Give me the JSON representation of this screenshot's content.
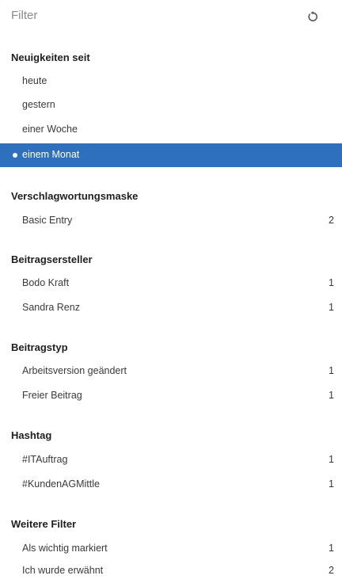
{
  "header": {
    "title": "Filter",
    "reset_icon": "reset-icon"
  },
  "sections": [
    {
      "title": "Neuigkeiten seit",
      "items": [
        {
          "label": "heute",
          "count": ""
        },
        {
          "label": "gestern",
          "count": ""
        },
        {
          "label": "einer Woche",
          "count": ""
        },
        {
          "label": "einem Monat",
          "count": "",
          "selected": true
        }
      ]
    },
    {
      "title": "Verschlagwortungsmaske",
      "items": [
        {
          "label": "Basic Entry",
          "count": "2"
        }
      ]
    },
    {
      "title": "Beitragsersteller",
      "items": [
        {
          "label": "Bodo Kraft",
          "count": "1"
        },
        {
          "label": "Sandra Renz",
          "count": "1"
        }
      ]
    },
    {
      "title": "Beitragstyp",
      "items": [
        {
          "label": "Arbeitsversion geändert",
          "count": "1"
        },
        {
          "label": "Freier Beitrag",
          "count": "1"
        }
      ]
    },
    {
      "title": "Hashtag",
      "items": [
        {
          "label": "#ITAuftrag",
          "count": "1"
        },
        {
          "label": "#KundenAGMittle",
          "count": "1"
        }
      ]
    },
    {
      "title": "Weitere Filter",
      "items": [
        {
          "label": "Als wichtig markiert",
          "count": "1"
        },
        {
          "label": "Ich wurde erwähnt",
          "count": "2"
        }
      ]
    }
  ],
  "colors": {
    "selected_bg": "#2e6fbe",
    "text": "#333333",
    "muted": "#8a8a8a"
  }
}
